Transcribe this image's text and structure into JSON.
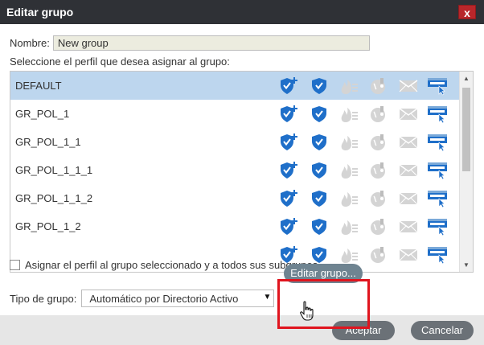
{
  "window": {
    "title": "Editar grupo",
    "close_label": "x"
  },
  "form": {
    "name_label": "Nombre:",
    "name_value": "New group",
    "instruction": "Seleccione el perfil que desea asignar al grupo:"
  },
  "profiles": [
    {
      "label": "DEFAULT",
      "selected": true
    },
    {
      "label": "GR_POL_1",
      "selected": false
    },
    {
      "label": "GR_POL_1_1",
      "selected": false
    },
    {
      "label": "GR_POL_1_1_1",
      "selected": false
    },
    {
      "label": "GR_POL_1_1_2",
      "selected": false
    },
    {
      "label": "GR_POL_1_2",
      "selected": false
    }
  ],
  "row_icons": [
    "shield-plus-icon",
    "shield-icon",
    "fire-list-icon",
    "usb-globe-icon",
    "mail-icon",
    "web-cursor-icon"
  ],
  "subgroups": {
    "label": "Asignar el perfil al grupo seleccionado y a todos sus subgrupos"
  },
  "group_type": {
    "label": "Tipo de grupo:",
    "selected": "Automático por Directorio Activo",
    "arrow": "▼"
  },
  "buttons": {
    "edit_group": "Editar grupo...",
    "accept": "Aceptar",
    "cancel": "Cancelar"
  },
  "scrollbar": {
    "up": "▲",
    "down": "▼"
  },
  "colors": {
    "titlebar": "#2f3136",
    "close": "#b8262a",
    "selected_row": "#bdd6ee",
    "shield_blue": "#1f6fc9",
    "highlight": "#e0141e",
    "button": "#6b7177",
    "edit_button": "#6f8491"
  }
}
